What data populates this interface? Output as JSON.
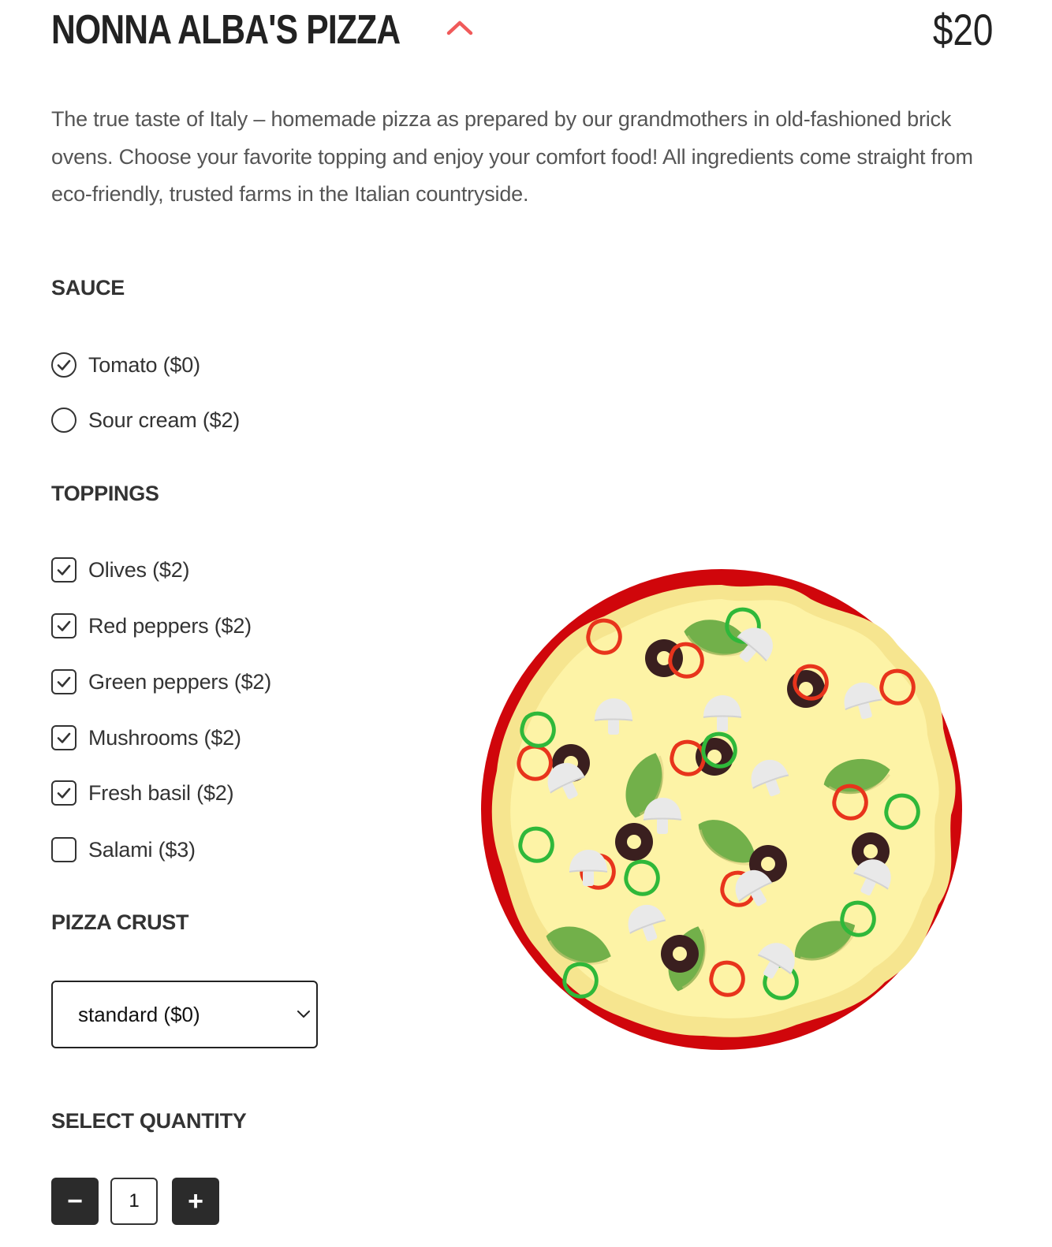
{
  "product": {
    "title": "NONNA ALBA'S PIZZA",
    "price": "$20",
    "description": "The true taste of Italy – homemade pizza as prepared by our grandmothers in old-fashioned brick ovens. Choose your favorite topping and enjoy your comfort food! All ingredients come straight from eco-friendly, trusted farms in the Italian countryside."
  },
  "sauce": {
    "title": "SAUCE",
    "options": [
      {
        "label": "Tomato ($0)",
        "selected": true
      },
      {
        "label": "Sour cream ($2)",
        "selected": false
      }
    ]
  },
  "toppings": {
    "title": "TOPPINGS",
    "options": [
      {
        "label": "Olives ($2)",
        "checked": true
      },
      {
        "label": "Red peppers ($2)",
        "checked": true
      },
      {
        "label": "Green peppers ($2)",
        "checked": true
      },
      {
        "label": "Mushrooms ($2)",
        "checked": true
      },
      {
        "label": "Fresh basil ($2)",
        "checked": true
      },
      {
        "label": "Salami ($3)",
        "checked": false
      }
    ]
  },
  "crust": {
    "title": "PIZZA CRUST",
    "selected": "standard ($0)"
  },
  "quantity": {
    "title": "SELECT QUANTITY",
    "value": "1",
    "minus_label": "−",
    "plus_label": "+"
  },
  "icons": {
    "collapse": "chevron-up-icon",
    "check": "checkmark-icon",
    "select_caret": "chevron-down-icon"
  },
  "colors": {
    "accent": "#f05a5a",
    "pizza_sauce": "#d0060b",
    "pizza_cheese": "#fdf3a6",
    "pizza_crust_edge": "#f6e58f",
    "basil": "#72b04a",
    "olive": "#3a1f1f",
    "red_pepper": "#e8341c",
    "green_pepper": "#2fb83a",
    "mushroom": "#e9e9e9",
    "button_dark": "#2b2b2b"
  }
}
